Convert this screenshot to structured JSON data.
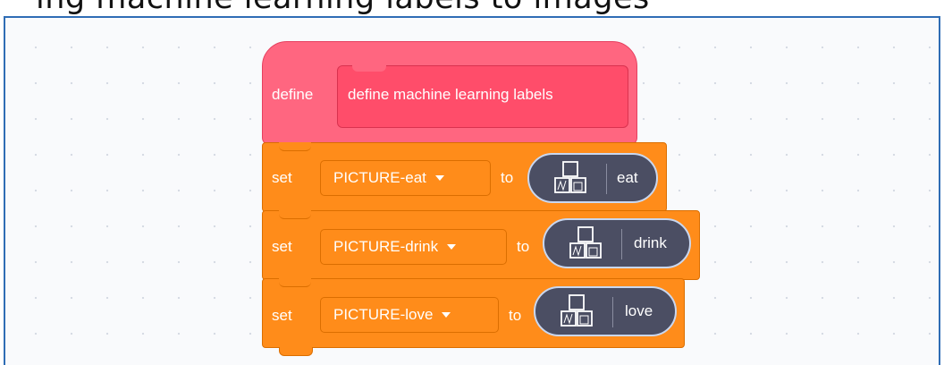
{
  "caption": "ing  machine learning  labels  to  images",
  "hat_block": {
    "keyword": "define",
    "prototype_label": "define machine learning labels"
  },
  "set_blocks": [
    {
      "keyword": "set",
      "variable": "PICTURE-eat",
      "to": "to",
      "label": "eat",
      "icon": "costume-stack-icon"
    },
    {
      "keyword": "set",
      "variable": "PICTURE-drink",
      "to": "to",
      "label": "drink",
      "icon": "costume-stack-icon"
    },
    {
      "keyword": "set",
      "variable": "PICTURE-love",
      "to": "to",
      "label": "love",
      "icon": "costume-stack-icon"
    }
  ],
  "colors": {
    "events_pink": "#ff6680",
    "variables_orange": "#ff8c1a",
    "reporter_dark": "#4b4e63",
    "frame_blue": "#2f6db5"
  }
}
